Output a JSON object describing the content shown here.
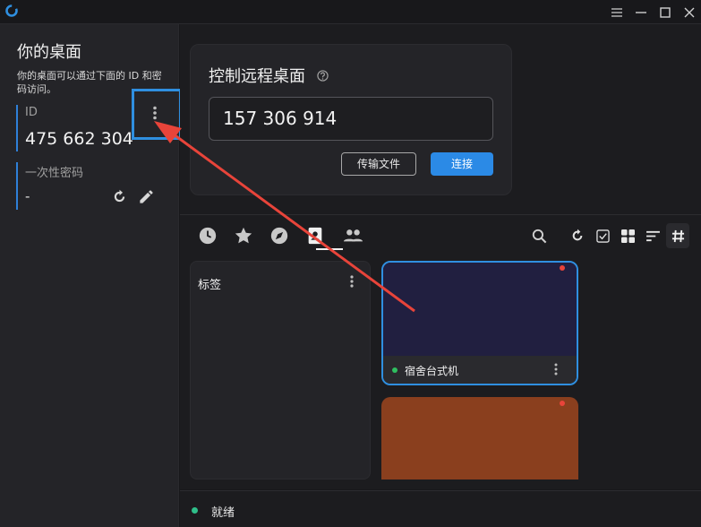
{
  "titlebar": {
    "logo_icon": "app-logo-icon",
    "controls": [
      "menu-icon",
      "minimize-icon",
      "maximize-icon",
      "close-icon"
    ]
  },
  "desktop": {
    "title": "你的桌面",
    "description": "你的桌面可以通过下面的 ID 和密码访问。",
    "id_label": "ID",
    "id_value": "475 662 304",
    "password_label": "一次性密码",
    "password_value": "-"
  },
  "remote": {
    "title": "控制远程桌面",
    "input_value": "157 306 914",
    "transfer_button": "传输文件",
    "connect_button": "连接"
  },
  "tabs": [
    "recent-sessions-icon",
    "favorites-icon",
    "discovered-icon",
    "address-book-icon",
    "group-icon"
  ],
  "active_tab": "address-book-icon",
  "toolbar": [
    "search-icon",
    "refresh-icon",
    "select-checkbox-icon",
    "grid-view-icon",
    "sort-icon",
    "tag-hash-icon"
  ],
  "tags_panel": {
    "title": "标签"
  },
  "peers": [
    {
      "name": "宿舍台式机",
      "online": true,
      "thumb_color": "#211f40"
    },
    {
      "name": "",
      "thumb_color": "#8a3f1e"
    }
  ],
  "status": {
    "text": "就绪",
    "color": "#2fbf8a"
  },
  "accent_color": "#2b8ae6",
  "annotation_color": "#e8443a"
}
